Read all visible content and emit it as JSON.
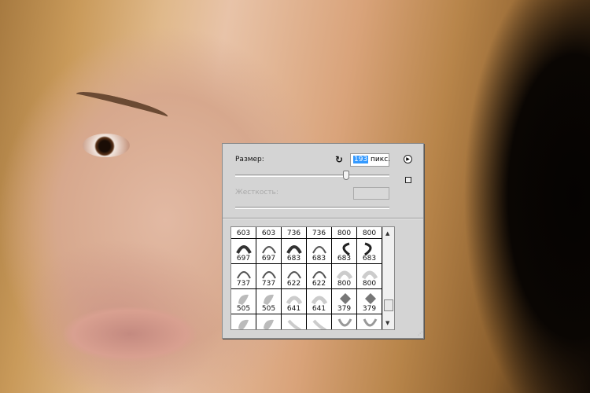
{
  "panel": {
    "size_label": "Размер:",
    "size_value": "193",
    "size_unit": " пикс.",
    "size_slider_fraction": 0.72,
    "hardness_label": "Жесткость:",
    "reset_icon": "rotate-ccw-icon",
    "menu_icon": "circle-play-icon"
  },
  "brushes": [
    {
      "size": "603",
      "shape": "dots"
    },
    {
      "size": "603",
      "shape": "dots"
    },
    {
      "size": "736",
      "shape": "dots"
    },
    {
      "size": "736",
      "shape": "dots"
    },
    {
      "size": "800",
      "shape": "none"
    },
    {
      "size": "800",
      "shape": "none"
    },
    {
      "size": "697",
      "shape": "arc-dark"
    },
    {
      "size": "697",
      "shape": "arc"
    },
    {
      "size": "683",
      "shape": "arc-dark"
    },
    {
      "size": "683",
      "shape": "arc"
    },
    {
      "size": "683",
      "shape": "c-left"
    },
    {
      "size": "683",
      "shape": "c-right"
    },
    {
      "size": "737",
      "shape": "arc"
    },
    {
      "size": "737",
      "shape": "arc"
    },
    {
      "size": "622",
      "shape": "arc"
    },
    {
      "size": "622",
      "shape": "arc"
    },
    {
      "size": "800",
      "shape": "soft"
    },
    {
      "size": "800",
      "shape": "soft"
    },
    {
      "size": "505",
      "shape": "blob"
    },
    {
      "size": "505",
      "shape": "blob"
    },
    {
      "size": "641",
      "shape": "soft"
    },
    {
      "size": "641",
      "shape": "soft"
    },
    {
      "size": "379",
      "shape": "diamond"
    },
    {
      "size": "379",
      "shape": "diamond"
    },
    {
      "size": "",
      "shape": "blob"
    },
    {
      "size": "",
      "shape": "blob"
    },
    {
      "size": "",
      "shape": "stroke"
    },
    {
      "size": "",
      "shape": "stroke"
    },
    {
      "size": "",
      "shape": "cup"
    },
    {
      "size": "",
      "shape": "cup"
    }
  ]
}
